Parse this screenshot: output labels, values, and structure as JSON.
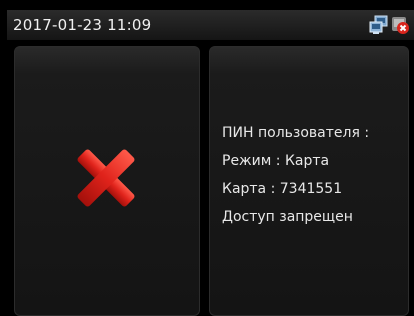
{
  "statusbar": {
    "datetime": "2017-01-23 11:09",
    "icons": [
      "network-icon",
      "error-status-icon"
    ]
  },
  "result": {
    "icon": "red-x-denied-icon",
    "accent": "#e0231b"
  },
  "info": {
    "pin_label": "ПИН пользователя :",
    "mode": "Режим : Карта",
    "card": "Карта : 7341551",
    "status": "Доступ запрещен"
  }
}
